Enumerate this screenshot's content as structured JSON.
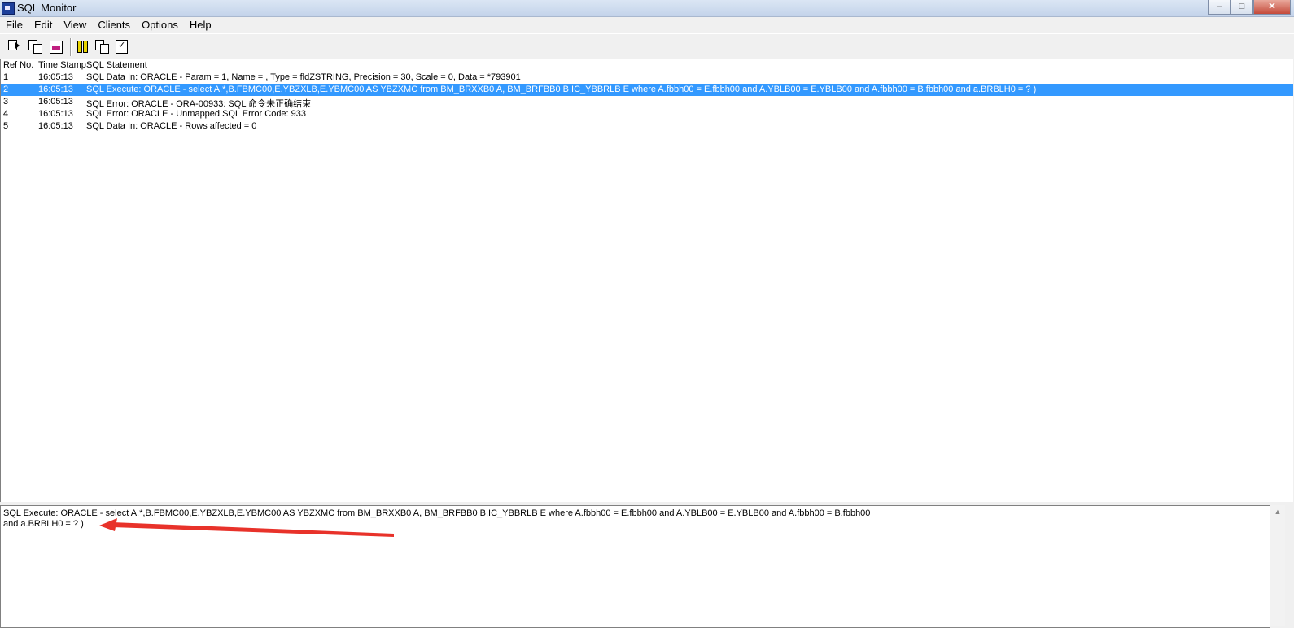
{
  "window": {
    "title": "SQL Monitor",
    "controls": {
      "minimize": "–",
      "maximize": "□",
      "close": "✕"
    }
  },
  "menu": [
    "File",
    "Edit",
    "View",
    "Clients",
    "Options",
    "Help"
  ],
  "toolbar": {
    "buttons": [
      "save-log-icon",
      "copy-icon",
      "font-color-icon",
      "pause-icon",
      "window-icon",
      "checklist-icon"
    ]
  },
  "list": {
    "headers": {
      "ref": "Ref No.",
      "time": "Time Stamp",
      "sql": "SQL Statement"
    },
    "rows": [
      {
        "ref": "1",
        "time": "16:05:13",
        "sql": "SQL Data In: ORACLE - Param = 1, Name = , Type = fldZSTRING, Precision = 30, Scale = 0, Data = *793901",
        "selected": false
      },
      {
        "ref": "2",
        "time": "16:05:13",
        "sql": "SQL Execute: ORACLE -  select   A.*,B.FBMC00,E.YBZXLB,E.YBMC00 AS YBZXMC   from  BM_BRXXB0 A, BM_BRFBB0 B,IC_YBBRLB E where  A.fbbh00 = E.fbbh00 and  A.YBLB00 =  E.YBLB00 and A.fbbh00 = B.fbbh00  and  a.BRBLH0 = ? )",
        "selected": true
      },
      {
        "ref": "3",
        "time": "16:05:13",
        "sql": "SQL Error: ORACLE - ORA-00933: SQL 命令未正确结束",
        "selected": false
      },
      {
        "ref": "4",
        "time": "16:05:13",
        "sql": "SQL Error: ORACLE - Unmapped SQL Error Code: 933",
        "selected": false
      },
      {
        "ref": "5",
        "time": "16:05:13",
        "sql": "SQL Data In: ORACLE - Rows affected = 0",
        "selected": false
      }
    ]
  },
  "detail": {
    "line1": "SQL Execute: ORACLE -  select   A.*,B.FBMC00,E.YBZXLB,E.YBMC00 AS YBZXMC   from  BM_BRXXB0 A, BM_BRFBB0 B,IC_YBBRLB E where  A.fbbh00 = E.fbbh00 and  A.YBLB00 =  E.YBLB00 and A.fbbh00 = B.fbbh00",
    "line2": " and  a.BRBLH0 = ? )",
    "scroll_up": "▲"
  },
  "annotation": {
    "arrow_color": "#e8322a"
  }
}
